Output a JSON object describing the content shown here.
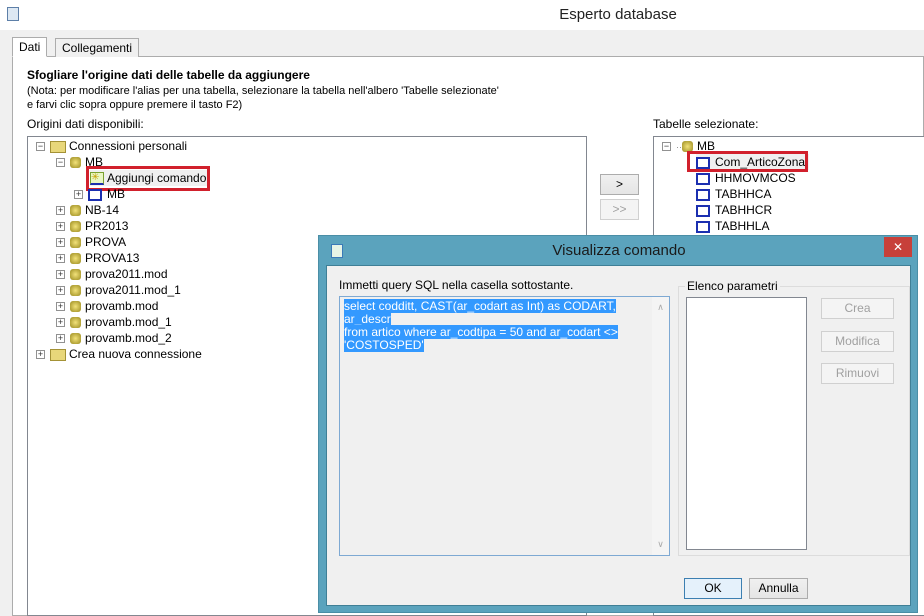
{
  "window": {
    "title": "Esperto database"
  },
  "tabs": [
    {
      "label": "Dati"
    },
    {
      "label": "Collegamenti"
    }
  ],
  "heading": "Sfogliare l'origine dati delle tabelle da aggiungere",
  "note_line1": "(Nota: per modificare l'alias per una tabella, selezionare la tabella nell'albero 'Tabelle selezionate'",
  "note_line2": "e farvi clic sopra oppure premere il tasto F2)",
  "available": {
    "label": "Origini dati disponibili:",
    "root": "Connessioni personali",
    "mb": "MB",
    "add_command": "Aggiungi comando",
    "mb_child": "MB",
    "items": [
      "NB-14",
      "PR2013",
      "PROVA",
      "PROVA13",
      "prova2011.mod",
      "prova2011.mod_1",
      "provamb.mod",
      "provamb.mod_1",
      "provamb.mod_2"
    ],
    "new_connection": "Crea nuova connessione"
  },
  "move": {
    "add": ">",
    "add_all": ">>"
  },
  "selected": {
    "label": "Tabelle selezionate:",
    "root": "MB",
    "tables": [
      "Com_ArticoZona",
      "HHMOVMCOS",
      "TABHHCA",
      "TABHHCR",
      "TABHHLA"
    ]
  },
  "dialog": {
    "title": "Visualizza comando",
    "close": "✕",
    "prompt": "Immetti query SQL nella casella sottostante.",
    "sql": [
      "select codditt, CAST(ar_codart as Int) as CODART, ar_descr",
      "from artico where ar_codtipa = 50 and ar_codart <>",
      "'COSTOSPED'"
    ],
    "params_label": "Elenco parametri",
    "create": "Crea",
    "modify": "Modifica",
    "remove": "Rimuovi",
    "ok": "OK",
    "cancel": "Annulla"
  }
}
